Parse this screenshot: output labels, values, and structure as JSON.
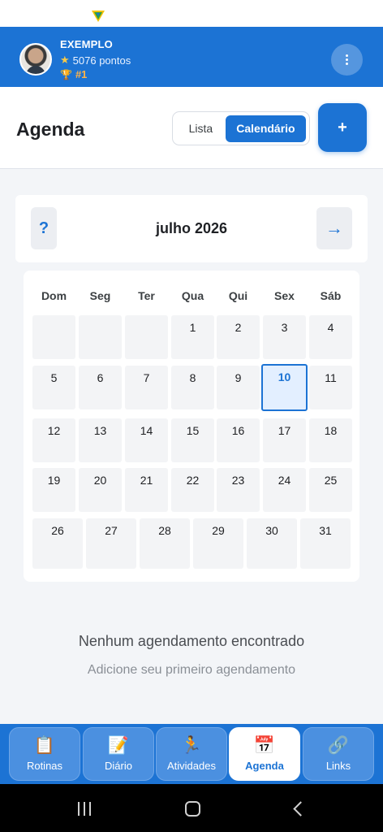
{
  "user": {
    "name": "EXEMPLO",
    "points": "5076 pontos",
    "rank": "#1"
  },
  "page": {
    "title": "Agenda",
    "toggle": {
      "list_label": "Lista",
      "calendar_label": "Calendário",
      "selected": "Calendário"
    },
    "add_label": "+"
  },
  "calendar": {
    "prev_label": "?",
    "next_label": "→",
    "month_label": "julho 2026",
    "weekdays": [
      "Dom",
      "Seg",
      "Ter",
      "Qua",
      "Qui",
      "Sex",
      "Sáb"
    ],
    "today": "10",
    "days": [
      "1",
      "2",
      "3",
      "4",
      "5",
      "6",
      "7",
      "8",
      "9",
      "10",
      "11",
      "12",
      "13",
      "14",
      "15",
      "16",
      "17",
      "18",
      "19",
      "20",
      "21",
      "22",
      "23",
      "24",
      "25",
      "26",
      "27",
      "28",
      "29",
      "30",
      "31"
    ]
  },
  "empty_state": {
    "title": "Nenhum agendamento encontrado",
    "subtitle": "Adicione seu primeiro agendamento"
  },
  "bottom_nav": {
    "items": [
      {
        "label": "Rotinas",
        "icon": "clipboard-icon"
      },
      {
        "label": "Diário",
        "icon": "memo-icon"
      },
      {
        "label": "Atividades",
        "icon": "runner-icon"
      },
      {
        "label": "Agenda",
        "icon": "calendar-icon"
      },
      {
        "label": "Links",
        "icon": "link-icon"
      }
    ],
    "active": "Agenda"
  },
  "colors": {
    "primary": "#1c73d4",
    "background": "#f3f5f8",
    "rank": "#ffb347"
  }
}
